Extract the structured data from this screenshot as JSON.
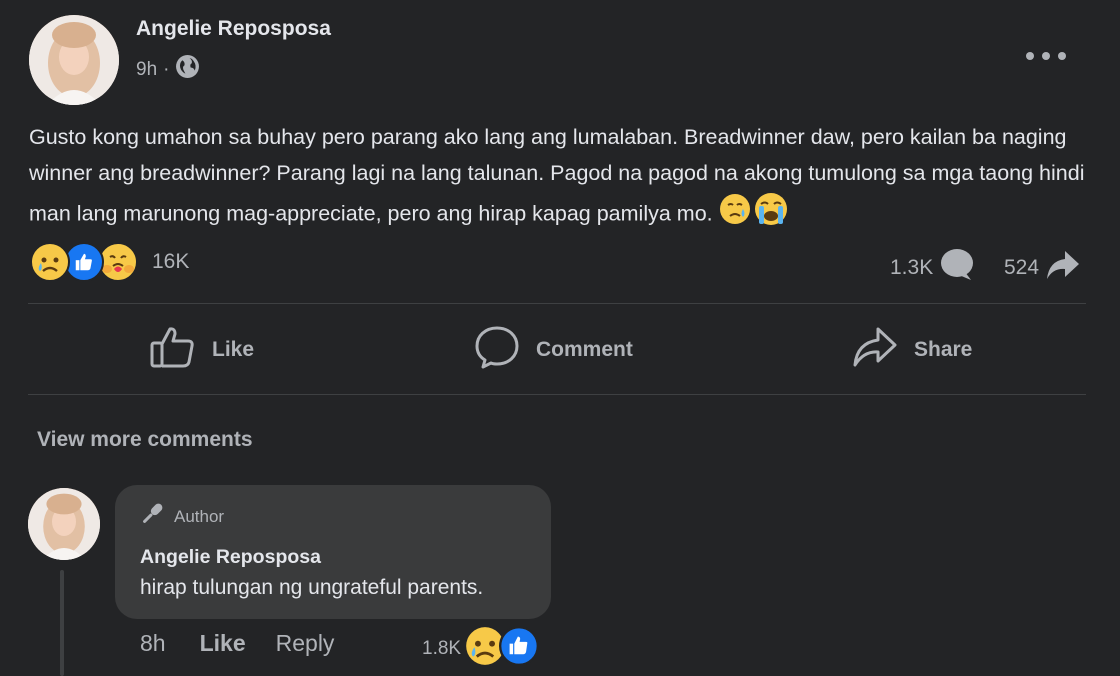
{
  "post": {
    "author": "Angelie Reposposa",
    "time": "9h",
    "text": "Gusto kong umahon sa buhay pero parang ako lang ang lumalaban. Breadwinner daw, pero kailan ba naging winner ang breadwinner? Parang lagi na lang talunan. Pagod na pagod na akong tumulong sa mga taong hindi man lang marunong mag-appreciate, pero ang hirap kapag pamilya mo.",
    "reactions_count": "16K",
    "comments_count": "1.3K",
    "shares_count": "524",
    "reaction_icons": [
      "sad-icon",
      "like-icon",
      "care-icon"
    ],
    "visibility_icon": "globe-icon"
  },
  "actions": {
    "like": "Like",
    "comment": "Comment",
    "share": "Share"
  },
  "comments": {
    "view_more": "View more comments",
    "items": [
      {
        "badge": "Author",
        "author": "Angelie Reposposa",
        "text": "hirap tulungan ng ungrateful parents.",
        "time": "8h",
        "like": "Like",
        "reply": "Reply",
        "reactions_count": "1.8K"
      }
    ]
  },
  "colors": {
    "background": "#232426",
    "bubble": "#3a3b3c",
    "text_primary": "#e4e6eb",
    "text_secondary": "#b0b3b8",
    "like_blue": "#1877f2",
    "reaction_yellow": "#f7c948"
  }
}
